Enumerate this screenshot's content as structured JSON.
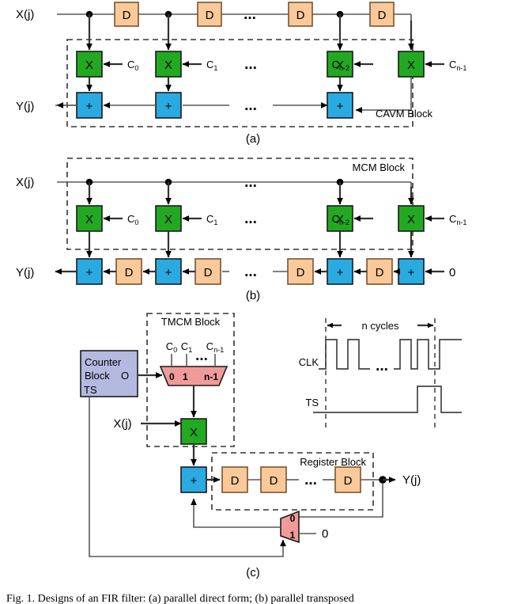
{
  "figure": {
    "caption": "Fig. 1.  Designs of an FIR filter: (a) parallel direct form; (b) parallel transposed"
  },
  "labels": {
    "x_input": "X(j)",
    "y_output": "Y(j)",
    "mul_symbol": "X",
    "add_symbol": "+",
    "reg_symbol": "D",
    "ellipsis": "...",
    "zero": "0",
    "panel_a": "(a)",
    "panel_b": "(b)",
    "panel_c": "(c)"
  },
  "coefficients": {
    "c0": "C",
    "c0_sub": "0",
    "c1": "C",
    "c1_sub": "1",
    "cn2": "C",
    "cn2_sub": "n-2",
    "cn1": "C",
    "cn1_sub": "n-1"
  },
  "panel_a": {
    "id": "(a)",
    "block_label": "CAVM Block",
    "input": "X(j)",
    "output": "Y(j)",
    "delay_count": 4,
    "mul_count": 4,
    "add_count": 3,
    "coeff_labels": [
      "C0",
      "C1",
      "Cn-2",
      "Cn-1"
    ]
  },
  "panel_b": {
    "id": "(b)",
    "block_label": "MCM Block",
    "input": "X(j)",
    "output": "Y(j)",
    "terminator": "0",
    "mul_count": 4,
    "coeff_labels": [
      "C0",
      "C1",
      "Cn-2",
      "Cn-1"
    ]
  },
  "panel_c": {
    "id": "(c)",
    "tmcm_label": "TMCM Block",
    "register_label": "Register Block",
    "counter_label_line1": "Counter",
    "counter_label_line2": "Block",
    "counter_out_port": "O",
    "counter_ts_port": "TS",
    "input": "X(j)",
    "output": "Y(j)",
    "mux_inputs": [
      "C0",
      "C1",
      "Cn-1"
    ],
    "mux_sel_labels": [
      "0",
      "1",
      "n-1"
    ],
    "feedback_mux_labels": [
      "0",
      "1"
    ],
    "feedback_zero": "0",
    "register_count": 3
  },
  "timing": {
    "span_label": "n cycles",
    "signals": [
      {
        "name": "CLK"
      },
      {
        "name": "TS"
      }
    ],
    "ellipsis": "..."
  },
  "colors": {
    "multiplier": "#22a922",
    "adder": "#29abe2",
    "register": "#f9c99a",
    "mux": "#f09a9a",
    "counter": "#b4b9e0",
    "wire": "#595959",
    "dash": "#333333"
  }
}
